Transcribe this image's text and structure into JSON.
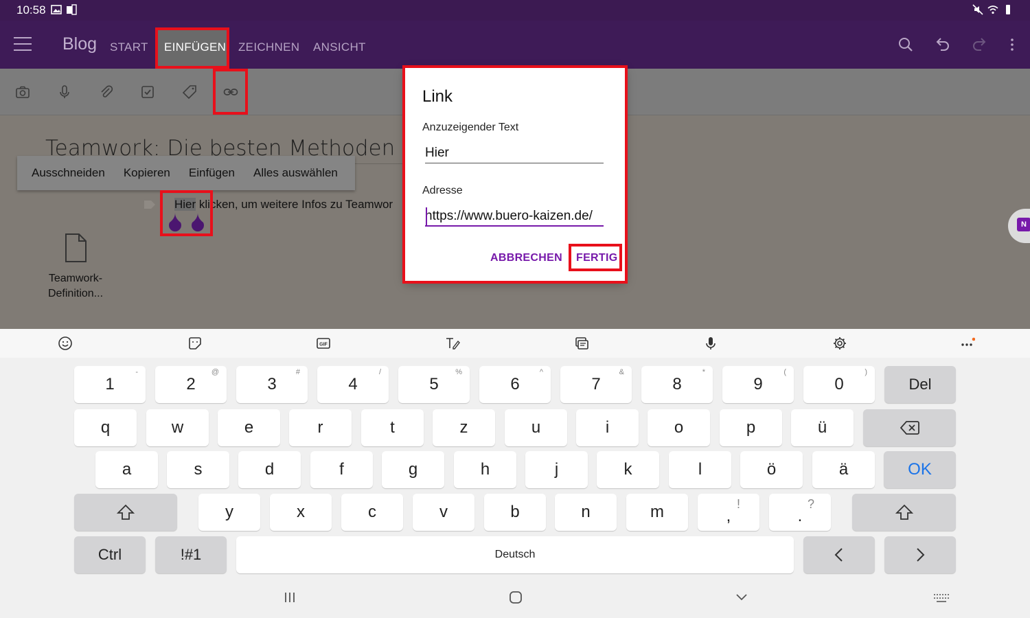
{
  "status_bar": {
    "time": "10:58"
  },
  "app_bar": {
    "notebook_title": "Blog",
    "tabs": [
      {
        "label": "START"
      },
      {
        "label": "EINFÜGEN"
      },
      {
        "label": "ZEICHNEN"
      },
      {
        "label": "ANSICHT"
      }
    ],
    "active_tab": "EINFÜGEN"
  },
  "ribbon": {
    "icons": [
      "camera-icon",
      "microphone-icon",
      "attachment-icon",
      "checkbox-icon",
      "tag-icon",
      "link-icon"
    ]
  },
  "page": {
    "title": "Teamwork: Die besten Methoden",
    "context_menu": [
      "Ausschneiden",
      "Kopieren",
      "Einfügen",
      "Alles auswählen"
    ],
    "paragraph_selected": "Hier",
    "paragraph_rest": " klicken, um weitere Infos zu Teamwor",
    "attachment_label_line1": "Teamwork-",
    "attachment_label_line2": "Definition..."
  },
  "dialog": {
    "title": "Link",
    "display_text_label": "Anzuzeigender Text",
    "display_text_value": "Hier",
    "address_label": "Adresse",
    "address_value": "https://www.buero-kaizen.de/",
    "cancel_label": "ABBRECHEN",
    "done_label": "FERTIG"
  },
  "keyboard": {
    "toolbar_icons": [
      "emoji-icon",
      "sticker-icon",
      "gif-icon",
      "handwriting-icon",
      "clipboard-icon",
      "voice-input-icon",
      "settings-icon",
      "more-icon"
    ],
    "row1": [
      {
        "k": "1",
        "h": "-"
      },
      {
        "k": "2",
        "h": "@"
      },
      {
        "k": "3",
        "h": "#"
      },
      {
        "k": "4",
        "h": "/"
      },
      {
        "k": "5",
        "h": "%"
      },
      {
        "k": "6",
        "h": "^"
      },
      {
        "k": "7",
        "h": "&"
      },
      {
        "k": "8",
        "h": "*"
      },
      {
        "k": "9",
        "h": "("
      },
      {
        "k": "0",
        "h": ")"
      }
    ],
    "del_label": "Del",
    "row2": [
      "q",
      "w",
      "e",
      "r",
      "t",
      "z",
      "u",
      "i",
      "o",
      "p",
      "ü"
    ],
    "row3": [
      "a",
      "s",
      "d",
      "f",
      "g",
      "h",
      "j",
      "k",
      "l",
      "ö",
      "ä"
    ],
    "ok_label": "OK",
    "row4": [
      "y",
      "x",
      "c",
      "v",
      "b",
      "n",
      "m"
    ],
    "comma_key": ",",
    "comma_hint": "!",
    "period_key": ".",
    "period_hint": "?",
    "ctrl_label": "Ctrl",
    "symbols_label": "!#1",
    "space_label": "Deutsch"
  }
}
